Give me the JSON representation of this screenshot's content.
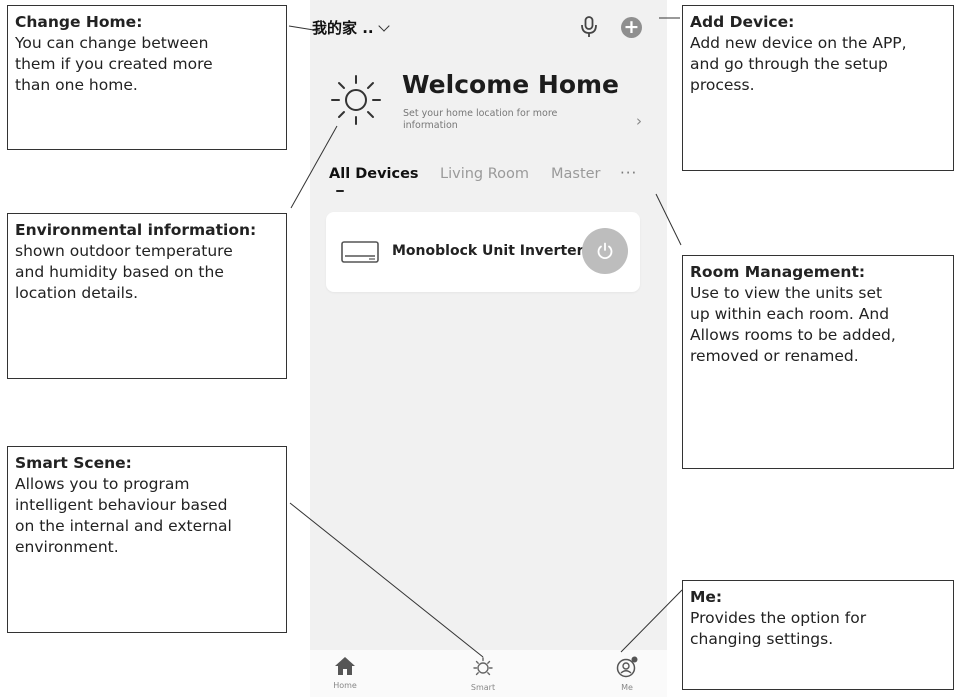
{
  "app": {
    "home_name": "我的家 ..",
    "welcome": {
      "title": "Welcome Home",
      "subtitle": "Set your home location for more information"
    },
    "tabs": [
      {
        "label": "All Devices",
        "active": true
      },
      {
        "label": "Living Room",
        "active": false
      },
      {
        "label": "Master",
        "active": false
      }
    ],
    "device": {
      "name": "Monoblock Unit Inverter",
      "power_icon": "power-icon"
    },
    "tabbar": [
      {
        "label": "Home",
        "icon": "home-icon"
      },
      {
        "label": "Smart",
        "icon": "sun-icon"
      },
      {
        "label": "Me",
        "icon": "user-icon"
      }
    ]
  },
  "annotations": {
    "change_home": {
      "title": "Change Home:",
      "body": "You can change between\nthem if you created more\nthan one home."
    },
    "environmental": {
      "title": "Environmental information:",
      "body": "shown outdoor temperature\nand humidity based on the\nlocation details."
    },
    "smart_scene": {
      "title": "Smart Scene:",
      "body": "Allows you to program\nintelligent behaviour based\non the internal and external\nenvironment."
    },
    "add_device": {
      "title": "Add Device:",
      "body": "Add new device on the APP,\nand go through the setup\nprocess."
    },
    "room_management": {
      "title": "Room Management:",
      "body": "Use to view the units set\nup within each room. And\nAllows rooms to be added,\nremoved or renamed."
    },
    "me": {
      "title": "Me:",
      "body": "Provides the option for\nchanging settings."
    }
  },
  "colors": {
    "phone_bg": "#f1f1f1",
    "power_button": "#bdbdbd",
    "add_button": "#8f8f8f"
  }
}
